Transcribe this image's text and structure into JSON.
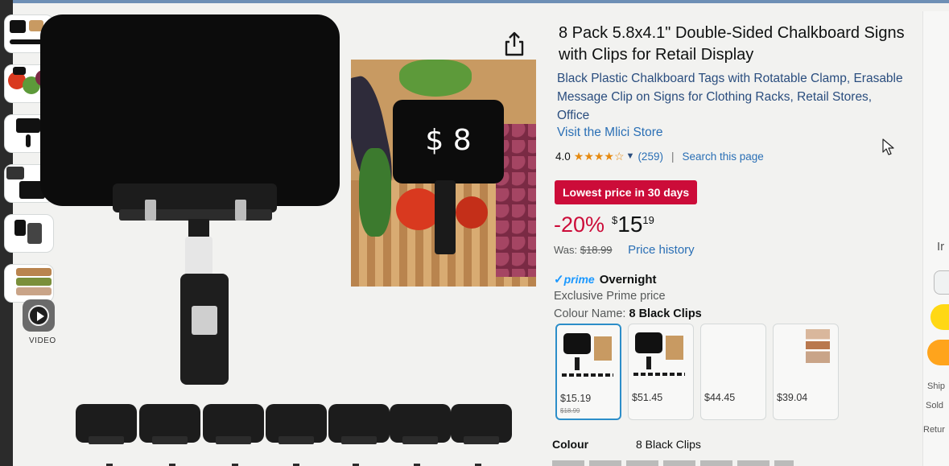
{
  "media": {
    "video_label": "VIDEO",
    "photo_price_tag": "$ 8"
  },
  "product": {
    "title": "8 Pack 5.8x4.1\" Double-Sided Chalkboard Signs with Clips for Retail Display",
    "subtitle": "Black Plastic Chalkboard Tags with Rotatable Clamp, Erasable Message Clip on Signs for Clothing Racks, Retail Stores, Office",
    "store_link": "Visit the Mlici Store",
    "rating": "4.0",
    "stars": "★★★★☆",
    "rating_count": "(259)",
    "separator": "|",
    "search_page": "Search this page"
  },
  "pricing": {
    "deal_badge": "Lowest price in 30 days",
    "discount": "-20%",
    "currency_symbol": "$",
    "price_whole": "15",
    "price_fraction": "19",
    "was_label": "Was:",
    "was_price": "$18.99",
    "price_history": "Price history"
  },
  "delivery": {
    "prime_check": "✓",
    "prime": "prime",
    "speed": "Overnight",
    "exclusive": "Exclusive Prime price"
  },
  "variant": {
    "colour_name_label": "Colour Name:",
    "colour_name_value": "8 Black Clips",
    "swatches": [
      {
        "price": "$15.19",
        "was": "$18.99",
        "selected": true
      },
      {
        "price": "$51.45",
        "was": "",
        "selected": false
      },
      {
        "price": "$44.45",
        "was": "",
        "selected": false
      },
      {
        "price": "$39.04",
        "was": "",
        "selected": false
      }
    ]
  },
  "details": {
    "colour_label": "Colour",
    "colour_value": "8 Black Clips"
  },
  "buy_box": {
    "partial_1": "Ir",
    "partial_2": "(",
    "ships": "Ship",
    "sold": "Sold",
    "returns": "Retur"
  },
  "colors": {
    "deal_red": "#cc0c39",
    "link_blue": "#2a6fb5",
    "prime_blue": "#1a98ff",
    "selected_border": "#2c8ec9",
    "star_orange": "#e58a10"
  }
}
